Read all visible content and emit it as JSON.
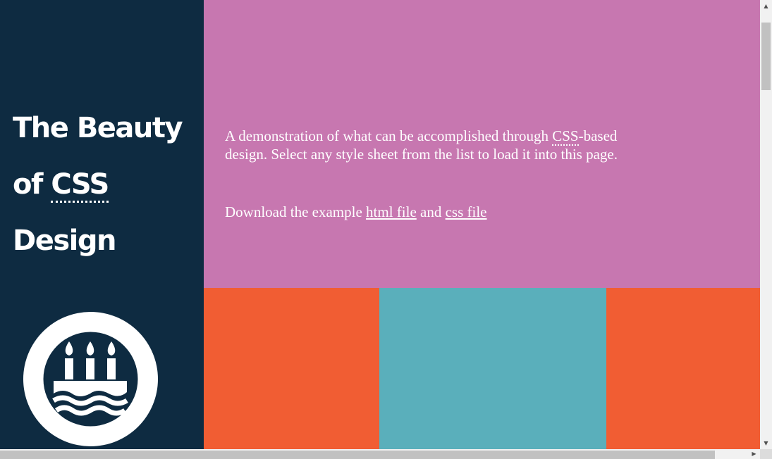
{
  "header": {
    "title_part1": "The Beauty of",
    "title_abbr": "CSS",
    "title_part2": "Design"
  },
  "logo": {
    "icon": "birthday-cake-icon"
  },
  "intro": {
    "text_before_abbr": "A demonstration of what can be accomplished through",
    "abbr": "CSS",
    "text_after_abbr": "-based design. Select any style sheet from the list to load it into this page.",
    "download_prefix": "Download the example",
    "html_link": "html file",
    "and_text": "and",
    "css_link": "css file"
  },
  "colors": {
    "sidebar": "#0e2b41",
    "intro": "#c777b0",
    "orange": "#f15d33",
    "teal": "#5aafbb"
  },
  "scrollbars": {
    "up_arrow": "▲",
    "down_arrow": "▼",
    "right_arrow": "▶"
  }
}
